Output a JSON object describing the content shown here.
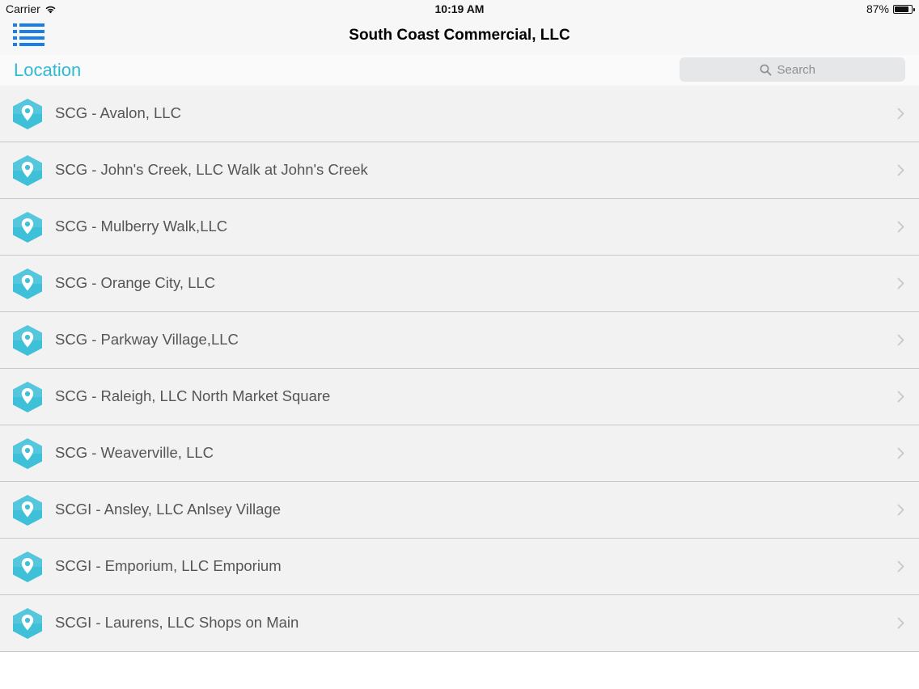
{
  "status_bar": {
    "carrier": "Carrier",
    "time": "10:19 AM",
    "battery_percent": "87%",
    "battery_level": 0.87
  },
  "nav_bar": {
    "title": "South Coast Commercial, LLC",
    "menu_icon": "list-icon"
  },
  "sub_header": {
    "title": "Location",
    "search_placeholder": "Search"
  },
  "colors": {
    "accent": "#2fbad3",
    "menu_icon": "#1a7ee6",
    "pin_icon": "#3dc0d8",
    "row_background": "#f2f2f3",
    "separator": "#c8c8cc"
  },
  "locations": [
    {
      "label": "SCG - Avalon, LLC"
    },
    {
      "label": "SCG - John's Creek, LLC Walk at John's Creek"
    },
    {
      "label": "SCG - Mulberry Walk,LLC"
    },
    {
      "label": "SCG - Orange City, LLC"
    },
    {
      "label": "SCG - Parkway Village,LLC"
    },
    {
      "label": "SCG - Raleigh, LLC North Market Square"
    },
    {
      "label": "SCG - Weaverville, LLC"
    },
    {
      "label": "SCGI - Ansley, LLC Anlsey Village"
    },
    {
      "label": "SCGI - Emporium, LLC Emporium"
    },
    {
      "label": "SCGI - Laurens, LLC Shops on Main"
    }
  ]
}
